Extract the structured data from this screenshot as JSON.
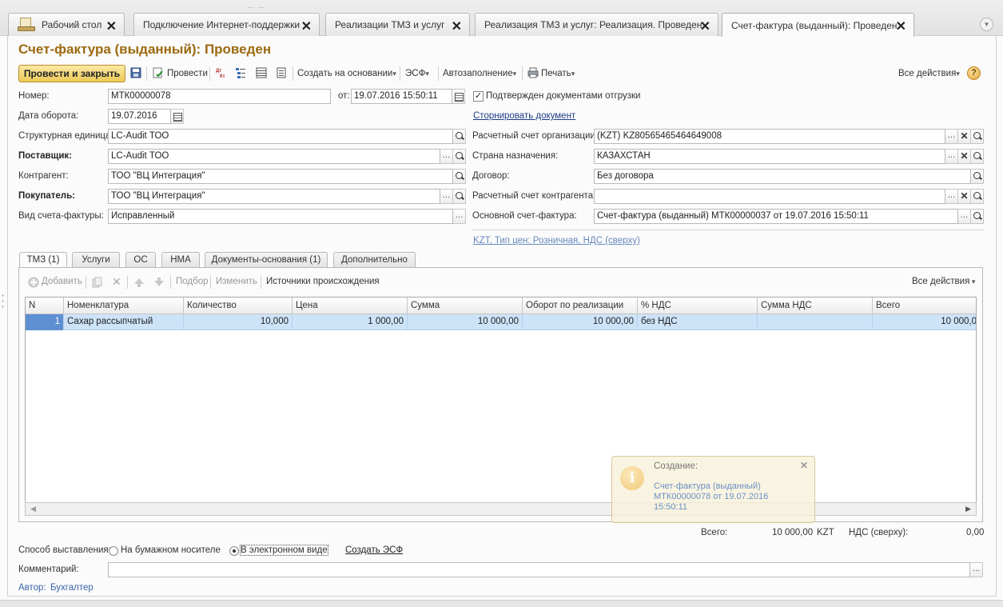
{
  "tabs": [
    {
      "label": "Рабочий стол"
    },
    {
      "label": "Подключение Интернет-поддержки"
    },
    {
      "label": "Реализации ТМЗ и услуг"
    },
    {
      "label": "Реализация ТМЗ и услуг: Реализация. Проведен"
    },
    {
      "label": "Счет-фактура (выданный): Проведен"
    }
  ],
  "title": "Счет-фактура (выданный): Проведен",
  "toolbar": {
    "post_close": "Провести и закрыть",
    "post": "Провести",
    "create_based": "Создать на основании",
    "esf": "ЭСФ",
    "autofill": "Автозаполнение",
    "print": "Печать",
    "all_actions": "Все действия",
    "help": "?"
  },
  "form": {
    "number_label": "Номер:",
    "number_value": "МТК00000078",
    "from_label": "от:",
    "from_value": "19.07.2016 15:50:11",
    "confirmed_label": "Подтвержден документами отгрузки",
    "turnover_date_label": "Дата оборота:",
    "turnover_date_value": "19.07.2016",
    "reverse_link": "Сторнировать документ",
    "struct_unit_label": "Структурная единица:",
    "struct_unit_value": "LC-Audit ТОО",
    "org_account_label": "Расчетный счет организации:",
    "org_account_value": "(KZT) KZ80565465464649008",
    "supplier_label": "Поставщик:",
    "supplier_value": "LC-Audit ТОО",
    "country_label": "Страна назначения:",
    "country_value": "КАЗАХСТАН",
    "counterparty_label": "Контрагент:",
    "counterparty_value": "ТОО \"ВЦ Интеграция\"",
    "contract_label": "Договор:",
    "contract_value": "Без договора",
    "buyer_label": "Покупатель:",
    "buyer_value": "ТОО \"ВЦ Интеграция\"",
    "cp_account_label": "Расчетный счет контрагента:",
    "cp_account_value": "",
    "invoice_type_label": "Вид счета-фактуры:",
    "invoice_type_value": "Исправленный",
    "base_invoice_label": "Основной счет-фактура:",
    "base_invoice_value": "Счет-фактура (выданный) МТК00000037 от 19.07.2016 15:50:11",
    "price_link": "KZT, Тип цен: Розничная, НДС (сверху)"
  },
  "inner_tabs": [
    {
      "label": "ТМЗ (1)"
    },
    {
      "label": "Услуги"
    },
    {
      "label": "ОС"
    },
    {
      "label": "НМА"
    },
    {
      "label": "Документы-основания (1)"
    },
    {
      "label": "Дополнительно"
    }
  ],
  "table_toolbar": {
    "add": "Добавить",
    "select": "Подбор",
    "edit": "Изменить",
    "sources": "Источники происхождения",
    "all_actions": "Все действия"
  },
  "table": {
    "columns": [
      "N",
      "Номенклатура",
      "Количество",
      "Цена",
      "Сумма",
      "Оборот по реализации",
      "% НДС",
      "Сумма НДС",
      "Всего"
    ],
    "rows": [
      {
        "n": "1",
        "item": "Сахар рассыпчатый",
        "qty": "10,000",
        "price": "1 000,00",
        "sum": "10 000,00",
        "turnover": "10 000,00",
        "vat_rate": "без НДС",
        "vat_sum": "",
        "total": "10 000,0"
      }
    ]
  },
  "popup": {
    "title": "Создание:",
    "text": "Счет-фактура (выданный) МТК00000078 от 19.07.2016 15:50:11"
  },
  "totals": {
    "total_label": "Всего:",
    "total_value": "10 000,00",
    "currency": "KZT",
    "vat_label": "НДС (сверху):",
    "vat_value": "0,00"
  },
  "footer": {
    "method_label": "Способ выставления:",
    "paper": "На бумажном носителе",
    "electronic": "В электронном виде",
    "create_esf": "Создать ЭСФ",
    "comment_label": "Комментарий:",
    "comment_value": "",
    "author_label": "Автор:",
    "author_value": "Бухгалтер"
  }
}
